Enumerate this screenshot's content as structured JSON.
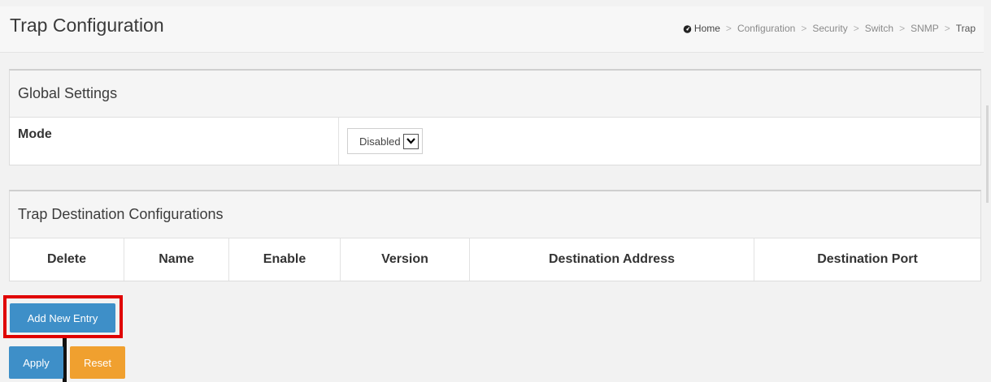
{
  "header": {
    "title": "Trap Configuration",
    "breadcrumb": [
      "Home",
      "Configuration",
      "Security",
      "Switch",
      "SNMP",
      "Trap"
    ],
    "breadcrumb_separator": ">"
  },
  "global_settings": {
    "title": "Global Settings",
    "mode_label": "Mode",
    "mode_value": "Disabled"
  },
  "trap_destinations": {
    "title": "Trap Destination Configurations",
    "columns": [
      "Delete",
      "Name",
      "Enable",
      "Version",
      "Destination Address",
      "Destination Port"
    ]
  },
  "buttons": {
    "add_new_entry": "Add New Entry",
    "apply": "Apply",
    "reset": "Reset"
  },
  "colors": {
    "primary_button": "#3e8fc8",
    "reset_button": "#f0a02f",
    "highlight": "#e00000"
  },
  "icons": {
    "home": "dashboard-icon"
  }
}
